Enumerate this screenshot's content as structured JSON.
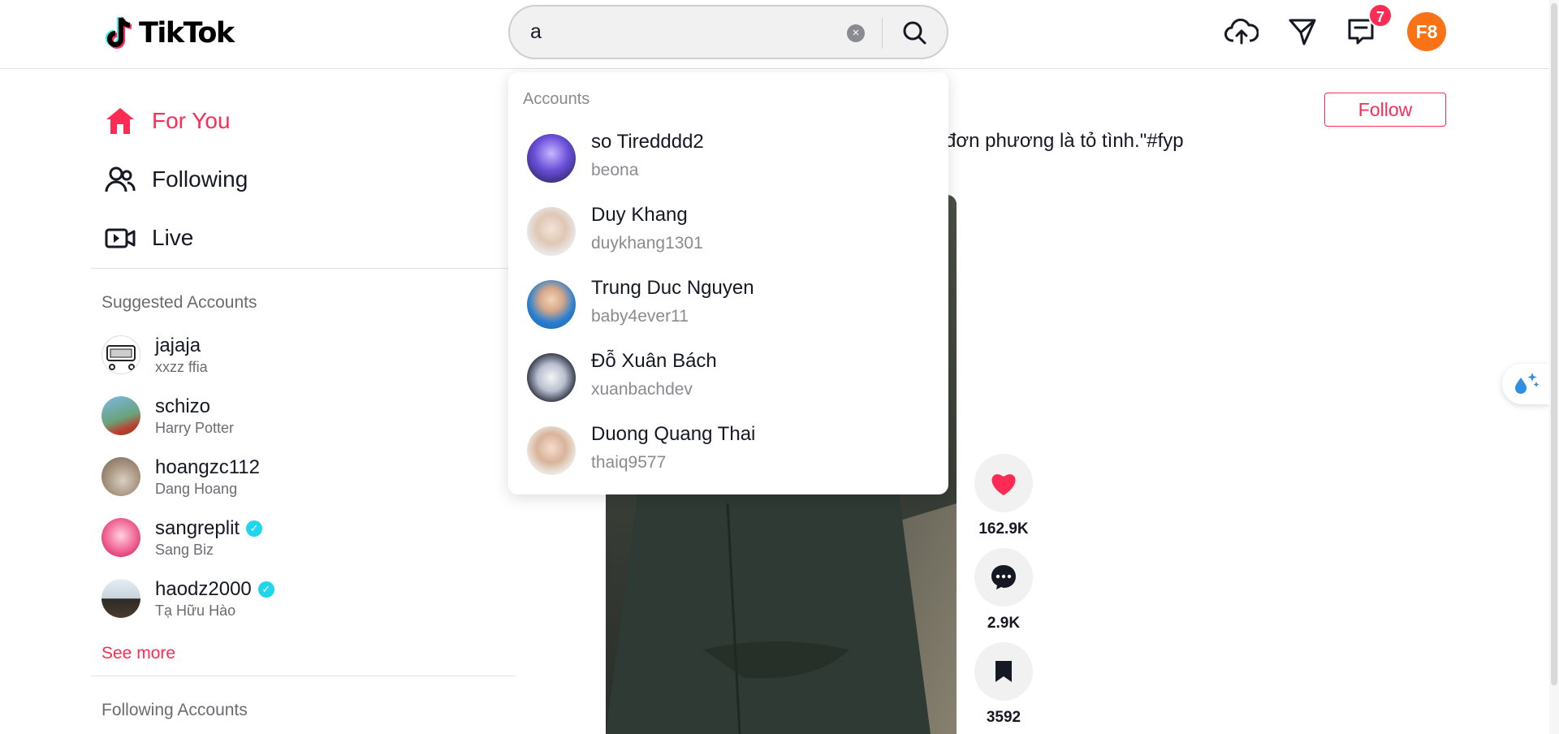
{
  "header": {
    "logo_text": "TikTok",
    "search": {
      "value": "a",
      "placeholder": "Search"
    },
    "notification_count": "7",
    "user_initials": "F8"
  },
  "sidebar": {
    "nav": [
      {
        "label": "For You",
        "icon": "home-icon",
        "active": true
      },
      {
        "label": "Following",
        "icon": "users-icon",
        "active": false
      },
      {
        "label": "Live",
        "icon": "live-video-icon",
        "active": false
      }
    ],
    "suggested_heading": "Suggested Accounts",
    "suggested": [
      {
        "name": "jajaja",
        "sub": "xxzz ffia",
        "verified": false
      },
      {
        "name": "schizo",
        "sub": "Harry Potter",
        "verified": false
      },
      {
        "name": "hoangzc112",
        "sub": "Dang Hoang",
        "verified": false
      },
      {
        "name": "sangreplit",
        "sub": "Sang Biz",
        "verified": true
      },
      {
        "name": "haodz2000",
        "sub": "Tạ Hữu Hào",
        "verified": true
      }
    ],
    "see_more": "See more",
    "following_heading": "Following Accounts"
  },
  "search_dropdown": {
    "heading": "Accounts",
    "results": [
      {
        "name": "so Tiredddd2",
        "username": "beona"
      },
      {
        "name": "Duy Khang",
        "username": "duykhang1301"
      },
      {
        "name": "Trung Duc Nguyen",
        "username": "baby4ever11"
      },
      {
        "name": "Đỗ Xuân Bách",
        "username": "xuanbachdev"
      },
      {
        "name": "Duong Quang Thai",
        "username": "thaiq9577"
      }
    ]
  },
  "post": {
    "caption": "đơn phương là tỏ tình.\"#fyp",
    "follow_label": "Follow",
    "likes": "162.9K",
    "comments": "2.9K",
    "saves": "3592"
  },
  "colors": {
    "accent": "#fe2c55",
    "verified": "#20d5ec",
    "avatar_me": "#f97316"
  }
}
